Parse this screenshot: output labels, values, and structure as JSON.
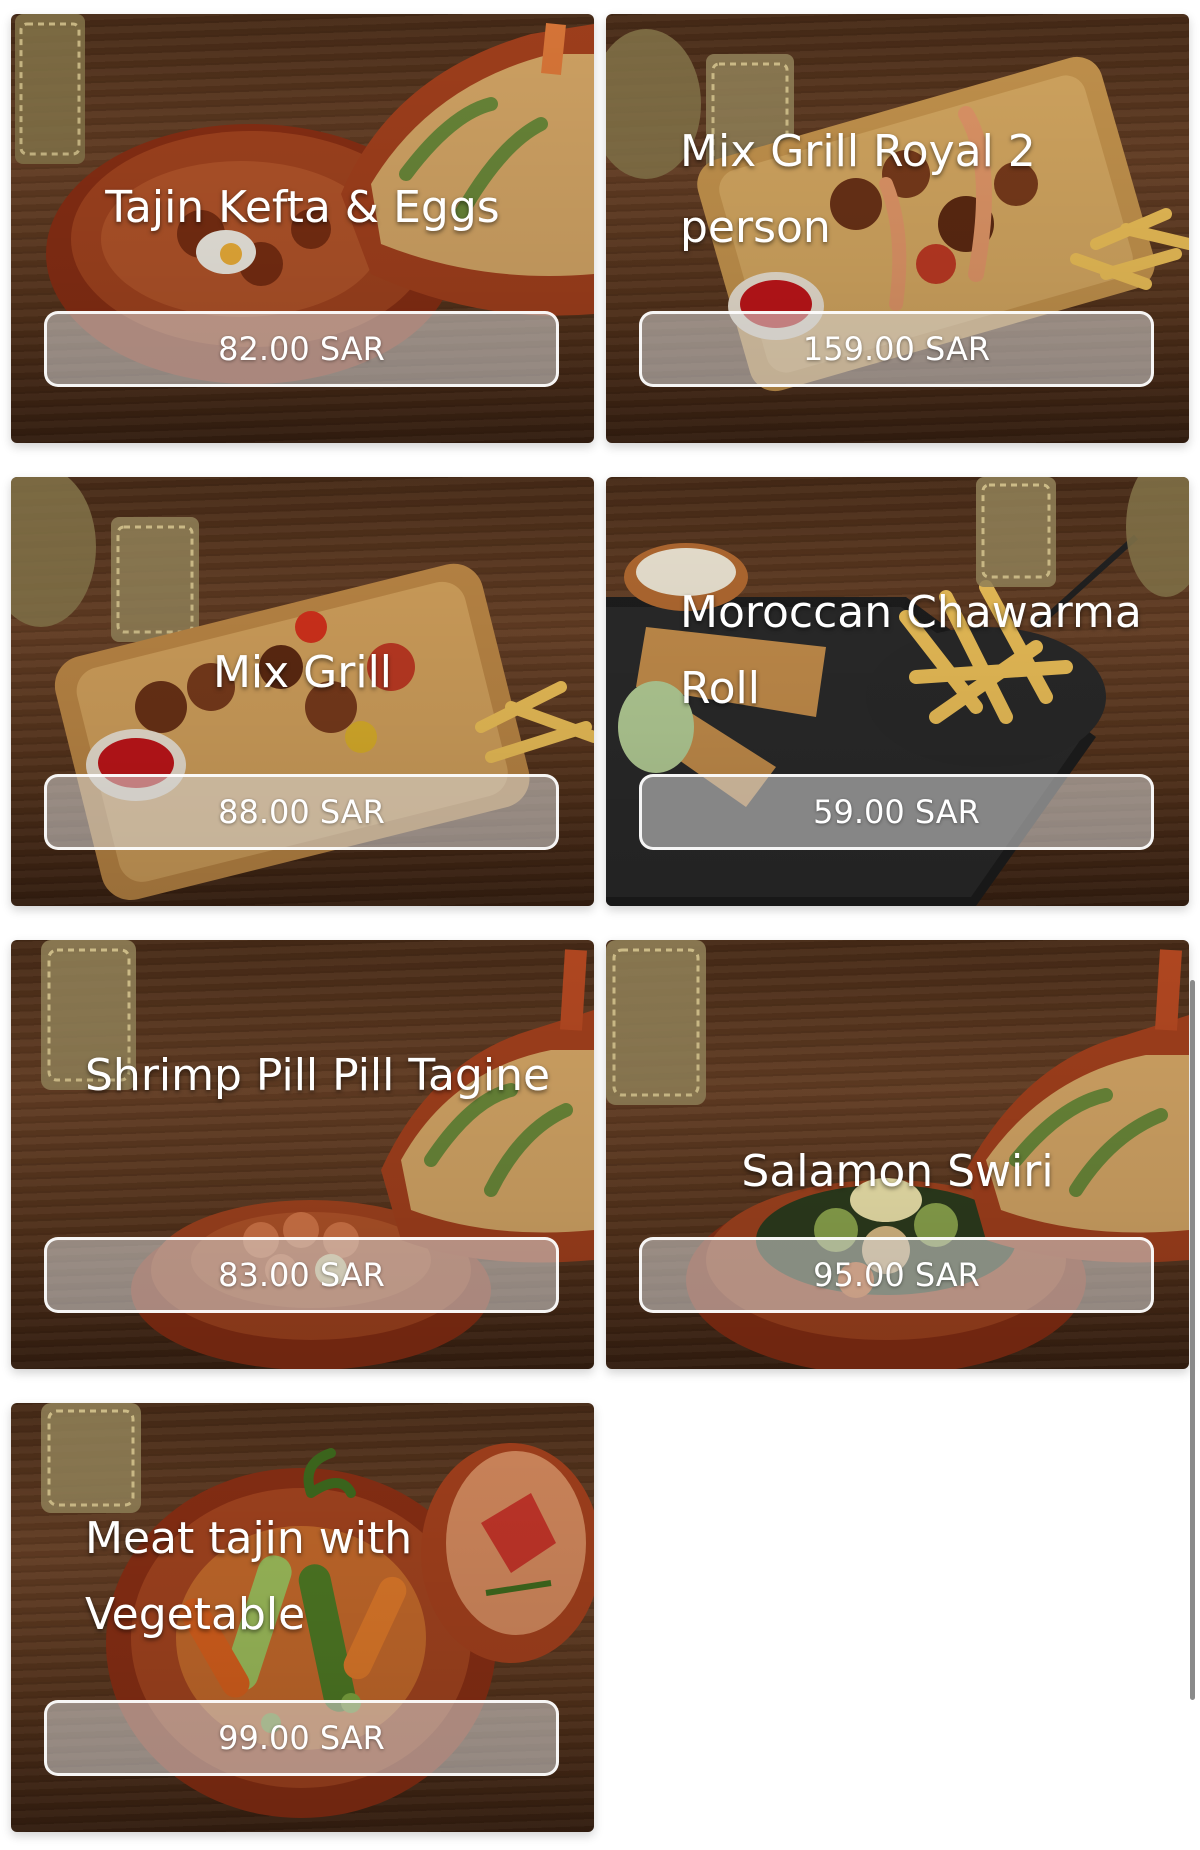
{
  "menu": {
    "items": [
      {
        "name": "Tajin Kefta & Eggs",
        "price": "82.00 SAR",
        "dish": "tagine-kefta"
      },
      {
        "name": "Mix Grill Royal 2 person",
        "price": "159.00 SAR",
        "dish": "grill-board"
      },
      {
        "name": "Mix Grill",
        "price": "88.00 SAR",
        "dish": "grill-board-small"
      },
      {
        "name": "Moroccan Chawarma Roll",
        "price": "59.00 SAR",
        "dish": "chawarma-fries"
      },
      {
        "name": "Shrimp Pill Pill Tagine",
        "price": "83.00 SAR",
        "dish": "tagine-shrimp"
      },
      {
        "name": "Salamon Swiri",
        "price": "95.00 SAR",
        "dish": "tagine-salmon"
      },
      {
        "name": "Meat tajin with Vegetable",
        "price": "99.00 SAR",
        "dish": "tagine-vegetable"
      }
    ]
  },
  "colors": {
    "wood": "#5a361d",
    "clay": "#a4441f",
    "button_fill": "rgba(215,215,215,0.55)",
    "text": "#ffffff"
  }
}
